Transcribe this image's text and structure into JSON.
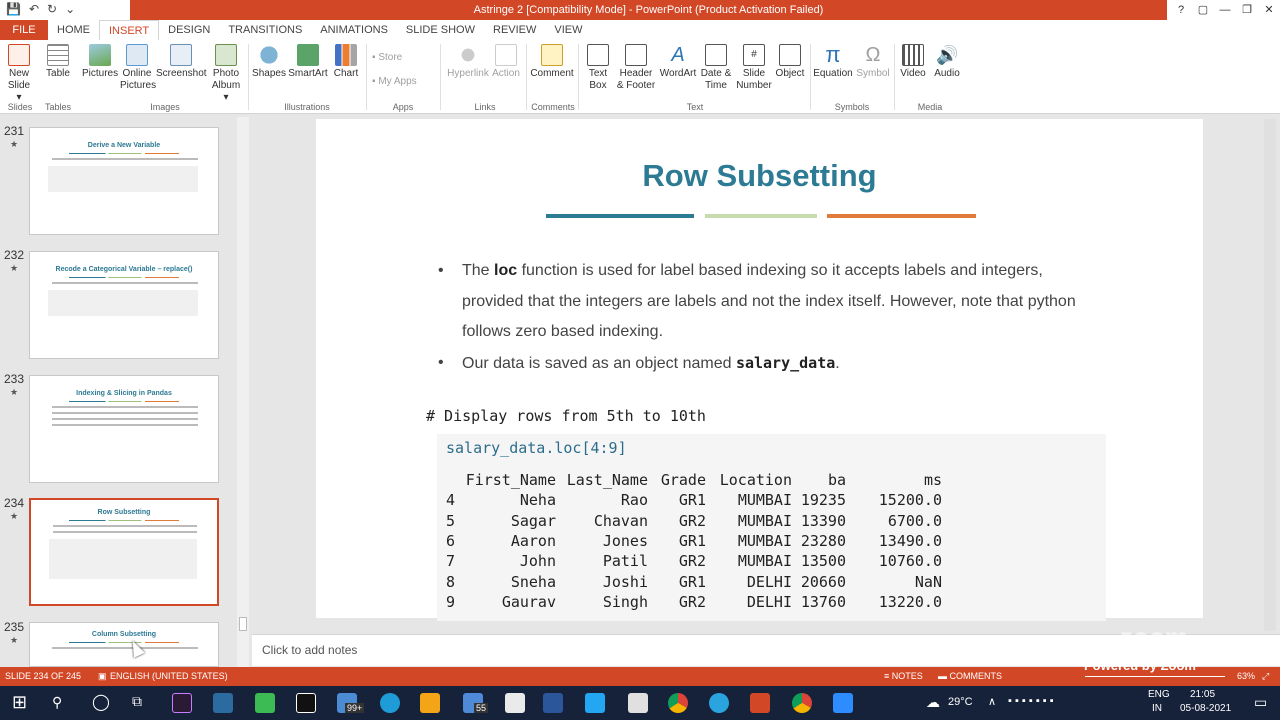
{
  "window": {
    "title": "Astringe 2 [Compatibility Mode] - PowerPoint (Product Activation Failed)",
    "controls": [
      "?",
      "▢",
      "—",
      "❐",
      "✕"
    ]
  },
  "tabs": [
    "FILE",
    "HOME",
    "INSERT",
    "DESIGN",
    "TRANSITIONS",
    "ANIMATIONS",
    "SLIDE SHOW",
    "REVIEW",
    "VIEW"
  ],
  "active_tab": "INSERT",
  "ribbon": {
    "new_slide": "New\nSlide ▾",
    "table": "Table",
    "pictures": "Pictures",
    "online_pictures": "Online\nPictures",
    "screenshot": "Screenshot",
    "photo_album": "Photo\nAlbum ▾",
    "shapes": "Shapes",
    "smartart": "SmartArt",
    "chart": "Chart",
    "store": "Store",
    "my_apps": "My Apps",
    "hyperlink": "Hyperlink",
    "action": "Action",
    "comment": "Comment",
    "text_box": "Text\nBox",
    "header_footer": "Header\n& Footer",
    "wordart": "WordArt",
    "date_time": "Date &\nTime",
    "slide_number": "Slide\nNumber",
    "object": "Object",
    "equation": "Equation",
    "symbol": "Symbol",
    "video": "Video",
    "audio": "Audio",
    "groups": {
      "slides": "Slides",
      "tables": "Tables",
      "images": "Images",
      "illustrations": "Illustrations",
      "apps": "Apps",
      "links": "Links",
      "comments": "Comments",
      "text": "Text",
      "symbols": "Symbols",
      "media": "Media"
    }
  },
  "thumbnails": [
    {
      "num": "231",
      "title": "Derive a New Variable"
    },
    {
      "num": "232",
      "title": "Recode a Categorical Variable – replace()"
    },
    {
      "num": "233",
      "title": "Indexing & Slicing in Pandas"
    },
    {
      "num": "234",
      "title": "Row Subsetting"
    },
    {
      "num": "235",
      "title": "Column Subsetting"
    }
  ],
  "slide": {
    "title": "Row Subsetting",
    "bullet1_pre": "The ",
    "bullet1_bold": "loc",
    "bullet1_post": " function is used for label based indexing so it accepts labels and integers, provided that the integers are labels and not the index itself. However, note that python follows zero based indexing.",
    "bullet2_pre": "Our data is saved as an object named ",
    "bullet2_code": "salary_data",
    "bullet2_post": ".",
    "comment": "# Display rows from 5th to 10th",
    "code": "salary_data.loc[4:9]",
    "table": {
      "columns": [
        "",
        "First_Name",
        "Last_Name",
        "Grade",
        "Location",
        "ba",
        "ms"
      ],
      "rows": [
        [
          "4",
          "Neha",
          "Rao",
          "GR1",
          "MUMBAI",
          "19235",
          "15200.0"
        ],
        [
          "5",
          "Sagar",
          "Chavan",
          "GR2",
          "MUMBAI",
          "13390",
          "6700.0"
        ],
        [
          "6",
          "Aaron",
          "Jones",
          "GR1",
          "MUMBAI",
          "23280",
          "13490.0"
        ],
        [
          "7",
          "John",
          "Patil",
          "GR2",
          "MUMBAI",
          "13500",
          "10760.0"
        ],
        [
          "8",
          "Sneha",
          "Joshi",
          "GR1",
          "DELHI",
          "20660",
          "NaN"
        ],
        [
          "9",
          "Gaurav",
          "Singh",
          "GR2",
          "DELHI",
          "13760",
          "13220.0"
        ]
      ]
    }
  },
  "notes_placeholder": "Click to add notes",
  "status": {
    "slide_info": "SLIDE 234 OF 245",
    "language": "ENGLISH (UNITED STATES)",
    "notes": "NOTES",
    "comments": "COMMENTS",
    "zoom": "63%"
  },
  "watermark": "zoom",
  "powered_by": "Powered by Zoom",
  "taskbar": {
    "badge": "99+",
    "badge2": "55",
    "weather": "29°C",
    "lang_line1": "ENG",
    "lang_line2": "IN",
    "time": "21:05",
    "date": "05-08-2021"
  },
  "colors": {
    "accent": "#d24726",
    "title_teal": "#2d7a94",
    "rule_green": "#9ec27e",
    "rule_orange": "#e07b39"
  }
}
